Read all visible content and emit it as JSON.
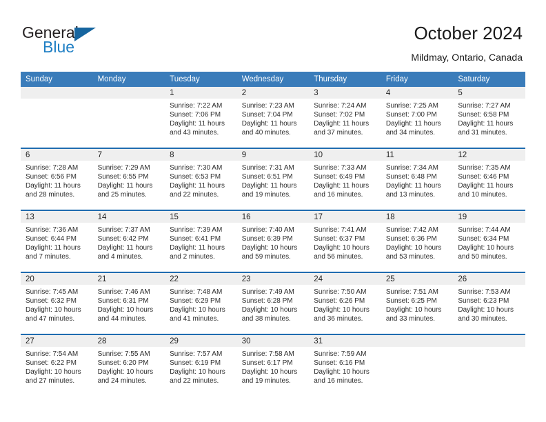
{
  "brand": {
    "word1": "General",
    "word2": "Blue",
    "accent_color": "#1f7fc4",
    "triangle_color": "#16659f"
  },
  "header": {
    "title": "October 2024",
    "subtitle": "Mildmay, Ontario, Canada"
  },
  "theme": {
    "header_row_bg": "#3a7cba",
    "week_divider": "#1f6cb0",
    "daynum_band_bg": "#efefef"
  },
  "weekdays": [
    "Sunday",
    "Monday",
    "Tuesday",
    "Wednesday",
    "Thursday",
    "Friday",
    "Saturday"
  ],
  "weeks": [
    [
      {
        "day": "",
        "sunrise": "",
        "sunset": "",
        "daylight_line1": "",
        "daylight_line2": "",
        "empty": true
      },
      {
        "day": "",
        "sunrise": "",
        "sunset": "",
        "daylight_line1": "",
        "daylight_line2": "",
        "empty": true
      },
      {
        "day": "1",
        "sunrise": "Sunrise: 7:22 AM",
        "sunset": "Sunset: 7:06 PM",
        "daylight_line1": "Daylight: 11 hours",
        "daylight_line2": "and 43 minutes."
      },
      {
        "day": "2",
        "sunrise": "Sunrise: 7:23 AM",
        "sunset": "Sunset: 7:04 PM",
        "daylight_line1": "Daylight: 11 hours",
        "daylight_line2": "and 40 minutes."
      },
      {
        "day": "3",
        "sunrise": "Sunrise: 7:24 AM",
        "sunset": "Sunset: 7:02 PM",
        "daylight_line1": "Daylight: 11 hours",
        "daylight_line2": "and 37 minutes."
      },
      {
        "day": "4",
        "sunrise": "Sunrise: 7:25 AM",
        "sunset": "Sunset: 7:00 PM",
        "daylight_line1": "Daylight: 11 hours",
        "daylight_line2": "and 34 minutes."
      },
      {
        "day": "5",
        "sunrise": "Sunrise: 7:27 AM",
        "sunset": "Sunset: 6:58 PM",
        "daylight_line1": "Daylight: 11 hours",
        "daylight_line2": "and 31 minutes."
      }
    ],
    [
      {
        "day": "6",
        "sunrise": "Sunrise: 7:28 AM",
        "sunset": "Sunset: 6:56 PM",
        "daylight_line1": "Daylight: 11 hours",
        "daylight_line2": "and 28 minutes."
      },
      {
        "day": "7",
        "sunrise": "Sunrise: 7:29 AM",
        "sunset": "Sunset: 6:55 PM",
        "daylight_line1": "Daylight: 11 hours",
        "daylight_line2": "and 25 minutes."
      },
      {
        "day": "8",
        "sunrise": "Sunrise: 7:30 AM",
        "sunset": "Sunset: 6:53 PM",
        "daylight_line1": "Daylight: 11 hours",
        "daylight_line2": "and 22 minutes."
      },
      {
        "day": "9",
        "sunrise": "Sunrise: 7:31 AM",
        "sunset": "Sunset: 6:51 PM",
        "daylight_line1": "Daylight: 11 hours",
        "daylight_line2": "and 19 minutes."
      },
      {
        "day": "10",
        "sunrise": "Sunrise: 7:33 AM",
        "sunset": "Sunset: 6:49 PM",
        "daylight_line1": "Daylight: 11 hours",
        "daylight_line2": "and 16 minutes."
      },
      {
        "day": "11",
        "sunrise": "Sunrise: 7:34 AM",
        "sunset": "Sunset: 6:48 PM",
        "daylight_line1": "Daylight: 11 hours",
        "daylight_line2": "and 13 minutes."
      },
      {
        "day": "12",
        "sunrise": "Sunrise: 7:35 AM",
        "sunset": "Sunset: 6:46 PM",
        "daylight_line1": "Daylight: 11 hours",
        "daylight_line2": "and 10 minutes."
      }
    ],
    [
      {
        "day": "13",
        "sunrise": "Sunrise: 7:36 AM",
        "sunset": "Sunset: 6:44 PM",
        "daylight_line1": "Daylight: 11 hours",
        "daylight_line2": "and 7 minutes."
      },
      {
        "day": "14",
        "sunrise": "Sunrise: 7:37 AM",
        "sunset": "Sunset: 6:42 PM",
        "daylight_line1": "Daylight: 11 hours",
        "daylight_line2": "and 4 minutes."
      },
      {
        "day": "15",
        "sunrise": "Sunrise: 7:39 AM",
        "sunset": "Sunset: 6:41 PM",
        "daylight_line1": "Daylight: 11 hours",
        "daylight_line2": "and 2 minutes."
      },
      {
        "day": "16",
        "sunrise": "Sunrise: 7:40 AM",
        "sunset": "Sunset: 6:39 PM",
        "daylight_line1": "Daylight: 10 hours",
        "daylight_line2": "and 59 minutes."
      },
      {
        "day": "17",
        "sunrise": "Sunrise: 7:41 AM",
        "sunset": "Sunset: 6:37 PM",
        "daylight_line1": "Daylight: 10 hours",
        "daylight_line2": "and 56 minutes."
      },
      {
        "day": "18",
        "sunrise": "Sunrise: 7:42 AM",
        "sunset": "Sunset: 6:36 PM",
        "daylight_line1": "Daylight: 10 hours",
        "daylight_line2": "and 53 minutes."
      },
      {
        "day": "19",
        "sunrise": "Sunrise: 7:44 AM",
        "sunset": "Sunset: 6:34 PM",
        "daylight_line1": "Daylight: 10 hours",
        "daylight_line2": "and 50 minutes."
      }
    ],
    [
      {
        "day": "20",
        "sunrise": "Sunrise: 7:45 AM",
        "sunset": "Sunset: 6:32 PM",
        "daylight_line1": "Daylight: 10 hours",
        "daylight_line2": "and 47 minutes."
      },
      {
        "day": "21",
        "sunrise": "Sunrise: 7:46 AM",
        "sunset": "Sunset: 6:31 PM",
        "daylight_line1": "Daylight: 10 hours",
        "daylight_line2": "and 44 minutes."
      },
      {
        "day": "22",
        "sunrise": "Sunrise: 7:48 AM",
        "sunset": "Sunset: 6:29 PM",
        "daylight_line1": "Daylight: 10 hours",
        "daylight_line2": "and 41 minutes."
      },
      {
        "day": "23",
        "sunrise": "Sunrise: 7:49 AM",
        "sunset": "Sunset: 6:28 PM",
        "daylight_line1": "Daylight: 10 hours",
        "daylight_line2": "and 38 minutes."
      },
      {
        "day": "24",
        "sunrise": "Sunrise: 7:50 AM",
        "sunset": "Sunset: 6:26 PM",
        "daylight_line1": "Daylight: 10 hours",
        "daylight_line2": "and 36 minutes."
      },
      {
        "day": "25",
        "sunrise": "Sunrise: 7:51 AM",
        "sunset": "Sunset: 6:25 PM",
        "daylight_line1": "Daylight: 10 hours",
        "daylight_line2": "and 33 minutes."
      },
      {
        "day": "26",
        "sunrise": "Sunrise: 7:53 AM",
        "sunset": "Sunset: 6:23 PM",
        "daylight_line1": "Daylight: 10 hours",
        "daylight_line2": "and 30 minutes."
      }
    ],
    [
      {
        "day": "27",
        "sunrise": "Sunrise: 7:54 AM",
        "sunset": "Sunset: 6:22 PM",
        "daylight_line1": "Daylight: 10 hours",
        "daylight_line2": "and 27 minutes."
      },
      {
        "day": "28",
        "sunrise": "Sunrise: 7:55 AM",
        "sunset": "Sunset: 6:20 PM",
        "daylight_line1": "Daylight: 10 hours",
        "daylight_line2": "and 24 minutes."
      },
      {
        "day": "29",
        "sunrise": "Sunrise: 7:57 AM",
        "sunset": "Sunset: 6:19 PM",
        "daylight_line1": "Daylight: 10 hours",
        "daylight_line2": "and 22 minutes."
      },
      {
        "day": "30",
        "sunrise": "Sunrise: 7:58 AM",
        "sunset": "Sunset: 6:17 PM",
        "daylight_line1": "Daylight: 10 hours",
        "daylight_line2": "and 19 minutes."
      },
      {
        "day": "31",
        "sunrise": "Sunrise: 7:59 AM",
        "sunset": "Sunset: 6:16 PM",
        "daylight_line1": "Daylight: 10 hours",
        "daylight_line2": "and 16 minutes."
      },
      {
        "day": "",
        "sunrise": "",
        "sunset": "",
        "daylight_line1": "",
        "daylight_line2": "",
        "empty": true
      },
      {
        "day": "",
        "sunrise": "",
        "sunset": "",
        "daylight_line1": "",
        "daylight_line2": "",
        "empty": true
      }
    ]
  ]
}
